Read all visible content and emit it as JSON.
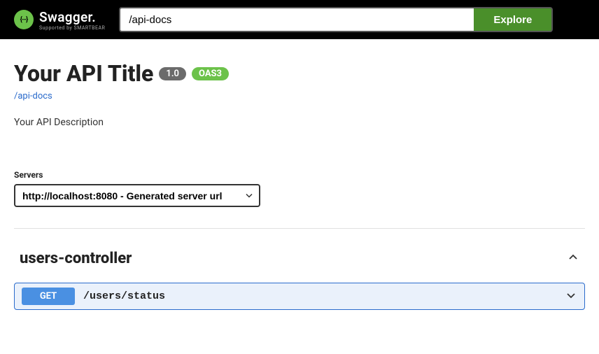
{
  "topbar": {
    "logo_text": "Swagger.",
    "logo_sub": "Supported by SMARTBEAR",
    "logo_glyph": "{···}",
    "search_value": "/api-docs",
    "explore_label": "Explore"
  },
  "info": {
    "title": "Your API Title",
    "version": "1.0",
    "oas_badge": "OAS3",
    "link": "/api-docs",
    "description": "Your API Description"
  },
  "servers": {
    "label": "Servers",
    "selected": "http://localhost:8080 - Generated server url"
  },
  "controller": {
    "name": "users-controller",
    "endpoints": [
      {
        "method": "GET",
        "path": "/users/status"
      }
    ]
  }
}
